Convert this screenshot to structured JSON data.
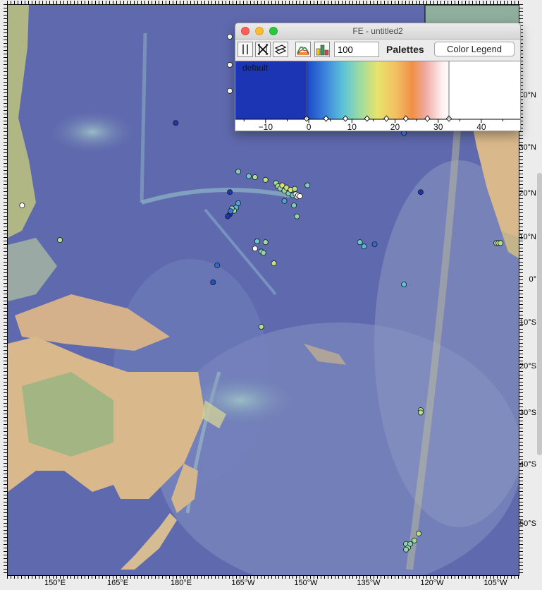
{
  "map": {
    "colors": {
      "ocean_deep": "#5d68ad",
      "ocean_shelf": "#7fa9bd",
      "land_green": "#8cb57f",
      "land_tan": "#d8b98f",
      "point_outline": "#1a1a1a"
    },
    "lon_labels": [
      "150°E",
      "165°E",
      "180°E",
      "165°W",
      "150°W",
      "135°W",
      "120°W",
      "105°W"
    ],
    "lat_labels": [
      "0°N",
      "30°N",
      "20°N",
      "10°N",
      "0°",
      "10°S",
      "20°S",
      "30°S",
      "40°S",
      "50°S"
    ],
    "points": [
      {
        "lon": -168.5,
        "lat": 50.0,
        "value": 40
      },
      {
        "lon": -168.5,
        "lat": 45.5,
        "value": 40
      },
      {
        "lon": -168.5,
        "lat": 41.0,
        "value": 40
      },
      {
        "lon": 178.6,
        "lat": 35.0,
        "value": -2
      },
      {
        "lon": -166.5,
        "lat": 25.0,
        "value": 10
      },
      {
        "lon": -164.0,
        "lat": 24.0,
        "value": 9
      },
      {
        "lon": -162.5,
        "lat": 23.8,
        "value": 13
      },
      {
        "lon": -160.0,
        "lat": 23.2,
        "value": 14
      },
      {
        "lon": -157.5,
        "lat": 22.5,
        "value": 12
      },
      {
        "lon": -157.0,
        "lat": 21.8,
        "value": 13
      },
      {
        "lon": -156.5,
        "lat": 21.3,
        "value": 11
      },
      {
        "lon": -156.0,
        "lat": 22.0,
        "value": 15
      },
      {
        "lon": -155.5,
        "lat": 20.8,
        "value": 12
      },
      {
        "lon": -155.0,
        "lat": 21.5,
        "value": 14
      },
      {
        "lon": -154.5,
        "lat": 20.2,
        "value": 10
      },
      {
        "lon": -154.0,
        "lat": 21.0,
        "value": 16
      },
      {
        "lon": -153.5,
        "lat": 19.8,
        "value": 9
      },
      {
        "lon": -153.0,
        "lat": 21.2,
        "value": 13
      },
      {
        "lon": -152.8,
        "lat": 20.0,
        "value": 40
      },
      {
        "lon": -152.5,
        "lat": 19.5,
        "value": 40
      },
      {
        "lon": -152.2,
        "lat": 19.8,
        "value": 40
      },
      {
        "lon": -151.8,
        "lat": 19.6,
        "value": 40
      },
      {
        "lon": -153.2,
        "lat": 17.5,
        "value": 10
      },
      {
        "lon": -155.5,
        "lat": 18.5,
        "value": 6
      },
      {
        "lon": -152.5,
        "lat": 15.0,
        "value": 11
      },
      {
        "lon": -150.0,
        "lat": 22.0,
        "value": 10
      },
      {
        "lon": -168.5,
        "lat": 20.5,
        "value": -4
      },
      {
        "lon": -166.5,
        "lat": 18.0,
        "value": 6
      },
      {
        "lon": -167.0,
        "lat": 17.0,
        "value": 7
      },
      {
        "lon": -167.5,
        "lat": 16.3,
        "value": 12
      },
      {
        "lon": -168.0,
        "lat": 16.8,
        "value": 10
      },
      {
        "lon": -168.5,
        "lat": 15.5,
        "value": -2
      },
      {
        "lon": -169.0,
        "lat": 15.0,
        "value": -3
      },
      {
        "lon": -168.3,
        "lat": 16.2,
        "value": 3
      },
      {
        "lon": -162.0,
        "lat": 9.2,
        "value": 9
      },
      {
        "lon": -161.0,
        "lat": 6.8,
        "value": 10
      },
      {
        "lon": -160.5,
        "lat": 6.5,
        "value": 11
      },
      {
        "lon": -160.0,
        "lat": 9.0,
        "value": 12
      },
      {
        "lon": -162.5,
        "lat": 7.5,
        "value": 40
      },
      {
        "lon": -158.0,
        "lat": 4.0,
        "value": 14
      },
      {
        "lon": -171.5,
        "lat": 3.5,
        "value": 2
      },
      {
        "lon": -172.5,
        "lat": -0.5,
        "value": 0
      },
      {
        "lon": 151.0,
        "lat": 9.5,
        "value": 13
      },
      {
        "lon": 142.0,
        "lat": 17.5,
        "value": 40
      },
      {
        "lon": -161.0,
        "lat": -11.0,
        "value": 13
      },
      {
        "lon": -137.5,
        "lat": 9.0,
        "value": 9
      },
      {
        "lon": -136.5,
        "lat": 8.0,
        "value": 7
      },
      {
        "lon": -134.0,
        "lat": 8.5,
        "value": 2
      },
      {
        "lon": -127.0,
        "lat": 33.0,
        "value": 4
      },
      {
        "lon": -123.0,
        "lat": 20.5,
        "value": -2
      },
      {
        "lon": -127.0,
        "lat": -1.0,
        "value": 8
      },
      {
        "lon": -105.0,
        "lat": 8.8,
        "value": 12
      },
      {
        "lon": -104.5,
        "lat": 8.8,
        "value": 14
      },
      {
        "lon": -104.0,
        "lat": 8.8,
        "value": 13
      },
      {
        "lon": -123.0,
        "lat": -29.5,
        "value": 14
      },
      {
        "lon": -123.0,
        "lat": -30.0,
        "value": 13
      },
      {
        "lon": -126.5,
        "lat": -53.0,
        "value": 11
      },
      {
        "lon": -126.0,
        "lat": -53.5,
        "value": 12
      },
      {
        "lon": -125.5,
        "lat": -53.0,
        "value": 10
      },
      {
        "lon": -124.5,
        "lat": -52.5,
        "value": 12
      },
      {
        "lon": -123.5,
        "lat": -51.5,
        "value": 13
      },
      {
        "lon": -126.5,
        "lat": -53.8,
        "value": 11
      }
    ]
  },
  "window": {
    "title": "FE - untitled2",
    "level_value": "100",
    "palettes_label": "Palettes",
    "color_legend_label": "Color Legend",
    "palette_name": "default",
    "axis": {
      "min": -17,
      "max": 49,
      "ticks": [
        -10,
        0,
        10,
        20,
        30,
        40
      ]
    },
    "palette_stops": [
      {
        "value": -17,
        "color": "#1b35b5"
      },
      {
        "value": -0.5,
        "color": "#1b35b5"
      },
      {
        "value": 0,
        "color": "#1f4fc7"
      },
      {
        "value": 4,
        "color": "#3e86de"
      },
      {
        "value": 8,
        "color": "#5cc4d8"
      },
      {
        "value": 12,
        "color": "#9fdc9f"
      },
      {
        "value": 16,
        "color": "#e8e36a"
      },
      {
        "value": 20,
        "color": "#f2c163"
      },
      {
        "value": 24,
        "color": "#f09047"
      },
      {
        "value": 27,
        "color": "#f0a9a0"
      },
      {
        "value": 31,
        "color": "#fdf0f2"
      },
      {
        "value": 33,
        "color": "#ffffff"
      },
      {
        "value": 49,
        "color": "#ffffff"
      }
    ],
    "node_values": [
      -0.5,
      4,
      8.5,
      13.5,
      18,
      22.5,
      27.5,
      32.5
    ]
  }
}
